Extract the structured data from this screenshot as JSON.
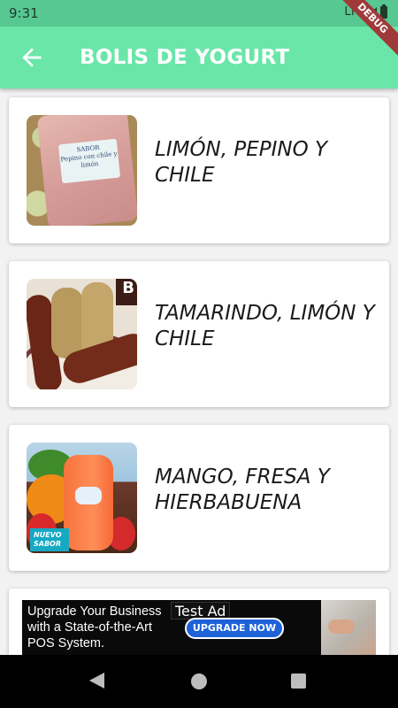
{
  "status_bar": {
    "time": "9:31",
    "network": "LTE",
    "icons": [
      "signal-icon",
      "battery-icon"
    ]
  },
  "debug_banner": "DEBUG",
  "app_bar": {
    "title": "BOLIS DE YOGURT",
    "back_icon": "arrow-back-icon",
    "background": "#6ae6a9"
  },
  "flavors": [
    {
      "title": "LIMÓN, PEPINO Y CHILE",
      "image_label": "SABOR\nPepino con chile y limón"
    },
    {
      "title": "TAMARINDO, LIMÓN Y CHILE",
      "image_corner_text": "B"
    },
    {
      "title": "MANGO, FRESA Y HIERBABUENA",
      "image_badge": "NUEVO SABOR"
    }
  ],
  "ad": {
    "text": "Upgrade Your Business with a State-of-the-Art POS System.",
    "tag": "Test Ad",
    "cta": "UPGRADE NOW"
  },
  "nav_bar": {
    "icons": [
      "nav-back-icon",
      "nav-home-icon",
      "nav-recents-icon"
    ]
  }
}
